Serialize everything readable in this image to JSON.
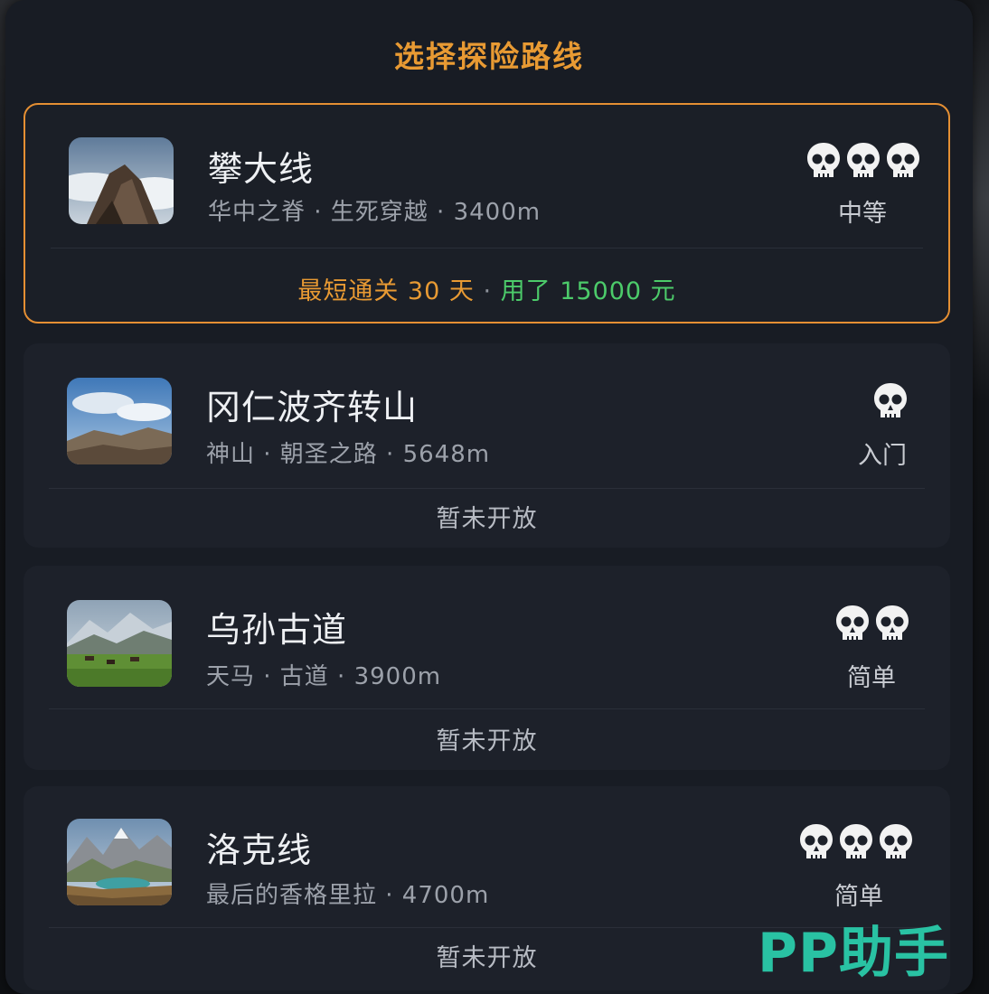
{
  "panel": {
    "title": "选择探险路线"
  },
  "routes": [
    {
      "name": "攀大线",
      "subtitle": "华中之脊 · 生死穿越 · 3400m",
      "difficulty_label": "中等",
      "difficulty_skulls": 3,
      "thumb_icon": "mountain-cloud-photo",
      "selected": true,
      "footer": {
        "shortest": "最短通关 30 天",
        "sep": " · ",
        "cost": "用了 15000 元"
      }
    },
    {
      "name": "冈仁波齐转山",
      "subtitle": "神山 · 朝圣之路 · 5648m",
      "difficulty_label": "入门",
      "difficulty_skulls": 1,
      "thumb_icon": "sky-plateau-photo",
      "selected": false,
      "footer_text": "暂未开放"
    },
    {
      "name": "乌孙古道",
      "subtitle": "天马 · 古道 · 3900m",
      "difficulty_label": "简单",
      "difficulty_skulls": 2,
      "thumb_icon": "grassland-horses-photo",
      "selected": false,
      "footer_text": "暂未开放"
    },
    {
      "name": "洛克线",
      "subtitle": "最后的香格里拉 · 4700m",
      "difficulty_label": "简单",
      "difficulty_skulls": 3,
      "thumb_icon": "lake-mountain-photo",
      "selected": false,
      "footer_text": "暂未开放"
    }
  ],
  "watermark": "PP助手",
  "colors": {
    "accent": "#e89a33",
    "cost_green": "#4ccb6a",
    "panel_bg": "#181c24",
    "card_bg": "#1d212a"
  }
}
